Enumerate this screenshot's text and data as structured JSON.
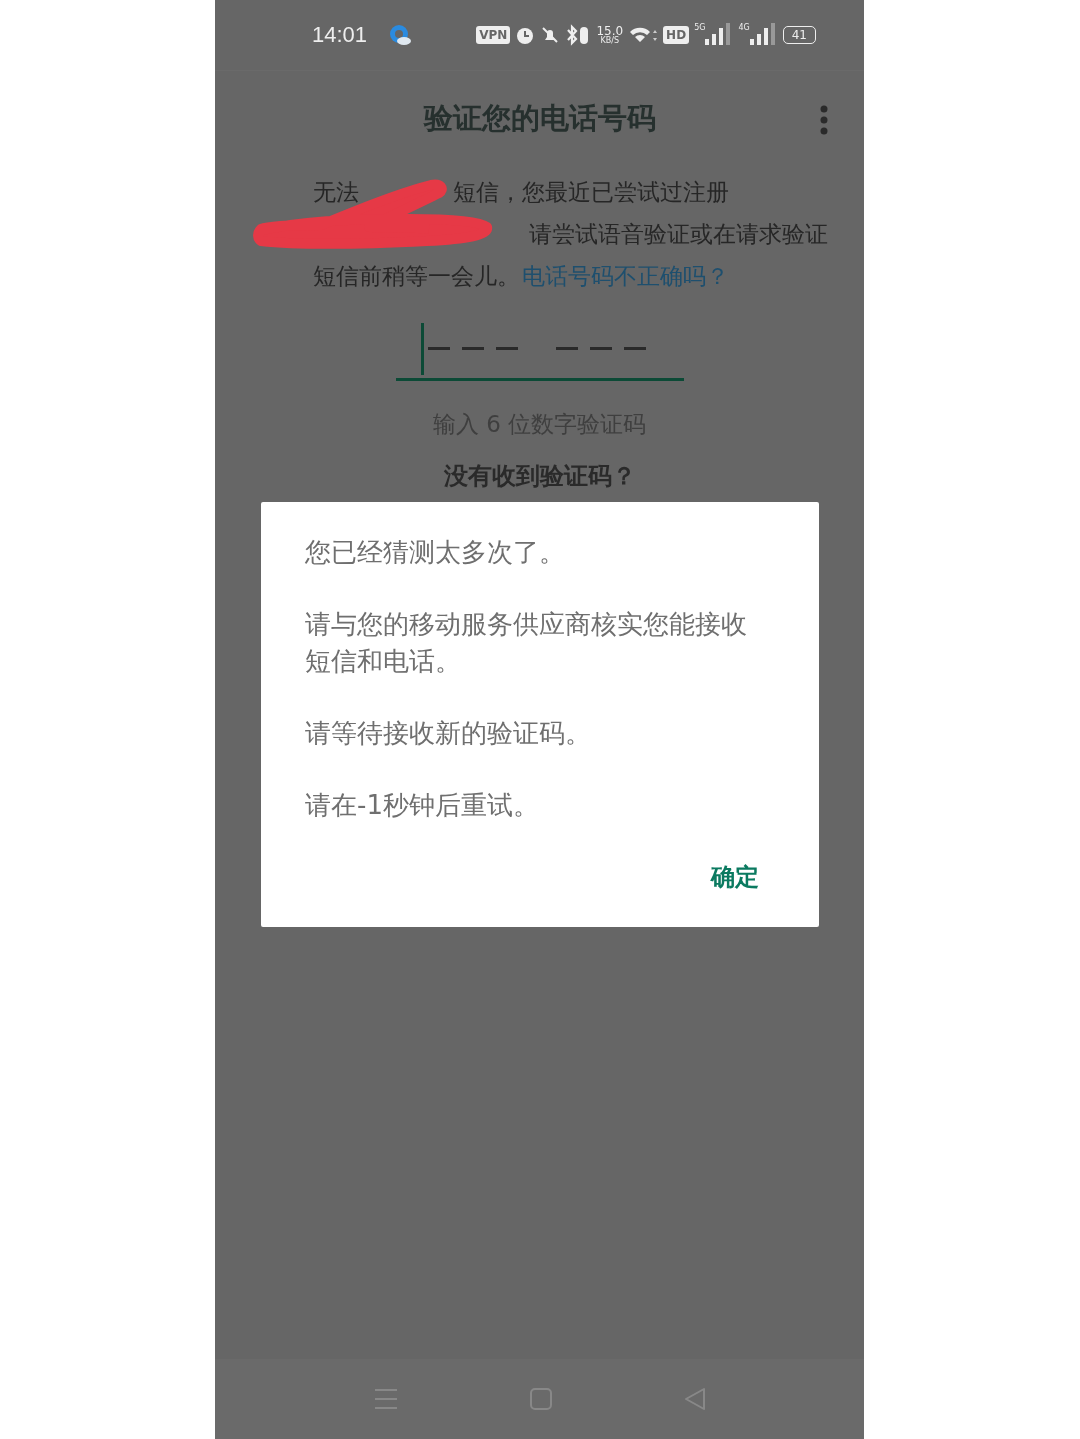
{
  "status_bar": {
    "time": "14:01",
    "vpn": "VPN",
    "speed": "15.0",
    "speed_unit": "KB/S",
    "hd": "HD",
    "networks": [
      "5G",
      "4G"
    ],
    "battery": "41"
  },
  "header": {
    "title": "验证您的电话号码"
  },
  "message": {
    "line_1_start": "无法",
    "line_1_end": "短信，您最近已尝试过注册",
    "line_2": "请尝试语音验证或在请求验证",
    "line_3": "短信前稍等一会儿。",
    "link": "电话号码不正确吗？"
  },
  "code_field": {
    "hint": "输入 6 位数字验证码"
  },
  "resend": "没有收到验证码？",
  "dialog": {
    "paragraphs": [
      "您已经猜测太多次了。",
      "请与您的移动服务供应商核实您能接收短信和电话。",
      "请等待接收新的验证码。",
      "请在-1秒钟后重试。"
    ],
    "button": "确定"
  }
}
